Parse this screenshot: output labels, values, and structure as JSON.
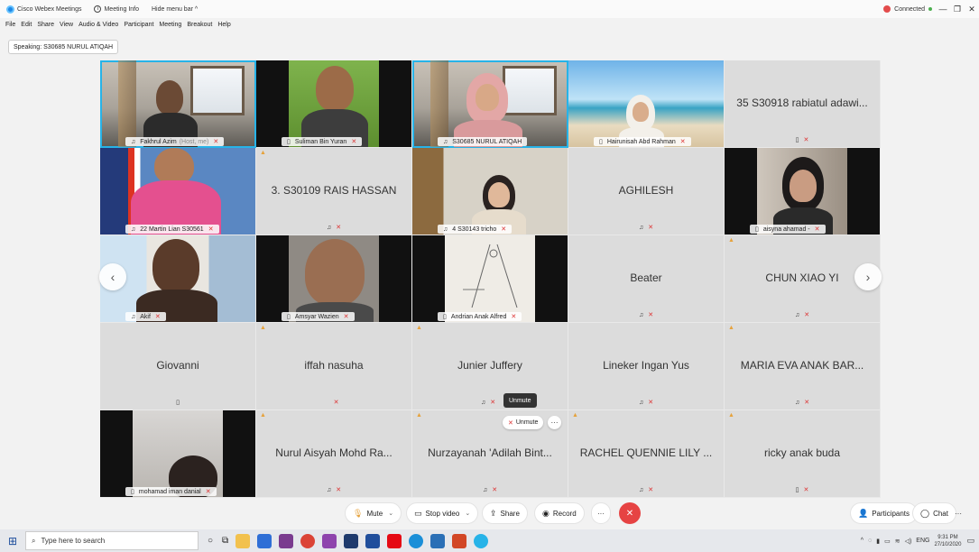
{
  "titlebar": {
    "app_name": "Cisco Webex Meetings",
    "meeting_info": "Meeting Info",
    "hide_menu": "Hide menu bar ^",
    "connected": "Connected",
    "minimize": "—",
    "restore": "❐",
    "close": "✕"
  },
  "menu": [
    "File",
    "Edit",
    "Share",
    "View",
    "Audio & Video",
    "Participant",
    "Meeting",
    "Breakout",
    "Help"
  ],
  "speaking_label": "Speaking: S30685 NURUL ATIQAH",
  "tiles": [
    {
      "name": "Fakhrul Azim",
      "suffix": "(Host, me)"
    },
    {
      "name": "Suliman Bin Yuran"
    },
    {
      "name": "S30685 NURUL ATIQAH"
    },
    {
      "name": "Hairunisah Abd Rahman"
    },
    {
      "name": "35 S30918 rabiatul adawi..."
    },
    {
      "name": "22 Martin Lian S30561"
    },
    {
      "name": "3. S30109 RAIS HASSAN"
    },
    {
      "name": "4 S30143 tricho"
    },
    {
      "name": "AGHILESH"
    },
    {
      "name": "aisyna ahamad -"
    },
    {
      "name": "Akif"
    },
    {
      "name": "Amsyar Wazien"
    },
    {
      "name": "Andrian Anak Alfred"
    },
    {
      "name": "Beater"
    },
    {
      "name": "CHUN XIAO YI"
    },
    {
      "name": "Giovanni"
    },
    {
      "name": "iffah nasuha"
    },
    {
      "name": "Junier Juffery"
    },
    {
      "name": "Lineker Ingan Yus"
    },
    {
      "name": "MARIA EVA ANAK BAR..."
    },
    {
      "name": "mohamad iman danial"
    },
    {
      "name": "Nurul Aisyah Mohd Ra..."
    },
    {
      "name": "Nurzayanah 'Adilah Bint..."
    },
    {
      "name": "RACHEL QUENNIE LILY ..."
    },
    {
      "name": "ricky anak buda"
    }
  ],
  "tooltip": "Unmute",
  "unmute_pill": "Unmute",
  "more_pill": "···",
  "controls": {
    "mute": "Mute",
    "stop_video": "Stop video",
    "share": "Share",
    "record": "Record",
    "more": "···",
    "end": "✕",
    "participants": "Participants",
    "chat": "Chat",
    "overflow": "···"
  },
  "taskbar": {
    "search_placeholder": "Type here to search",
    "lang": "ENG",
    "time": "9:31 PM",
    "date": "27/10/2020"
  },
  "colors": {
    "accent": "#27b3e8",
    "end_call": "#e64343",
    "muted_mic": "#d33333"
  }
}
